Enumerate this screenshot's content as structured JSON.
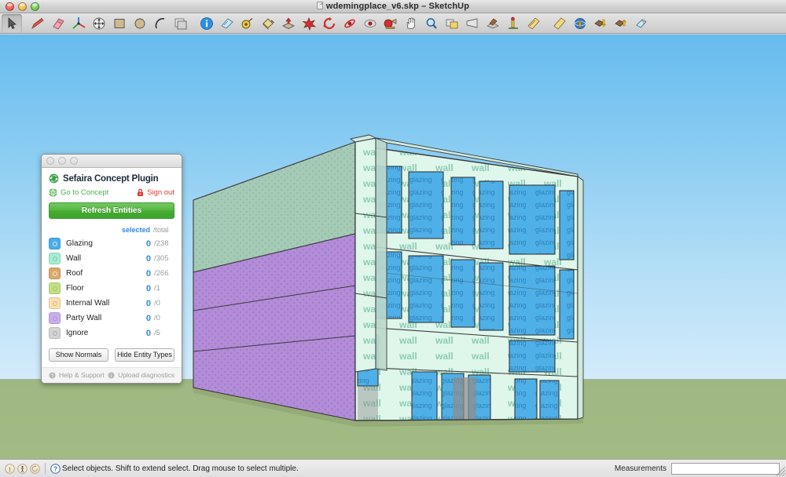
{
  "window": {
    "title": "wdemingplace_v6.skp – SketchUp",
    "app": "SketchUp",
    "document": "wdemingplace_v6.skp",
    "controls": [
      {
        "name": "close",
        "color": "#e0483c"
      },
      {
        "name": "minimize",
        "color": "#e8a62c"
      },
      {
        "name": "zoom",
        "color": "#4fb733"
      }
    ]
  },
  "toolbar": {
    "items": [
      {
        "name": "select-tool",
        "label": "Select",
        "active": true
      },
      {
        "name": "line-tool",
        "label": "Line",
        "active": false
      },
      {
        "name": "eraser-tool",
        "label": "Eraser",
        "active": false
      },
      {
        "name": "axes-tool",
        "label": "Axes",
        "active": false
      },
      {
        "name": "move-tool",
        "label": "Move",
        "active": false
      },
      {
        "name": "rectangle-tool",
        "label": "Rectangle",
        "active": false
      },
      {
        "name": "circle-tool",
        "label": "Circle",
        "active": false
      },
      {
        "name": "arc-tool",
        "label": "Arc",
        "active": false
      },
      {
        "name": "offset-tool",
        "label": "Offset",
        "active": false
      },
      {
        "name": "entity-info-tool",
        "label": "Entity Info",
        "active": false
      },
      {
        "name": "protractor-tool",
        "label": "Protractor",
        "active": false
      },
      {
        "name": "tape-measure-tool",
        "label": "Tape Measure",
        "active": false
      },
      {
        "name": "paint-bucket-tool",
        "label": "Paint Bucket",
        "active": false
      },
      {
        "name": "push-pull-tool",
        "label": "Push/Pull",
        "active": false
      },
      {
        "name": "follow-me-tool",
        "label": "Follow Me",
        "active": false
      },
      {
        "name": "rotate-tool",
        "label": "Rotate",
        "active": false
      },
      {
        "name": "orbit-tool",
        "label": "Orbit",
        "active": false
      },
      {
        "name": "look-around-tool",
        "label": "Look Around",
        "active": false
      },
      {
        "name": "walk-tool",
        "label": "Walk",
        "active": false
      },
      {
        "name": "pan-tool",
        "label": "Pan",
        "active": false
      },
      {
        "name": "zoom-tool",
        "label": "Zoom",
        "active": false
      },
      {
        "name": "zoom-extents-tool",
        "label": "Zoom Extents",
        "active": false
      },
      {
        "name": "zoom-window-tool",
        "label": "Zoom Window",
        "active": false
      },
      {
        "name": "previous-view-tool",
        "label": "Previous View",
        "active": false
      },
      {
        "name": "position-camera-tool",
        "label": "Position Camera",
        "active": false
      },
      {
        "name": "section-plane-tool",
        "label": "Section Plane",
        "active": false
      },
      {
        "name": "dimension-tool",
        "label": "Dimension",
        "active": false
      },
      {
        "name": "upload-model-tool",
        "label": "Share Model",
        "active": false
      },
      {
        "name": "download-component-tool",
        "label": "Get Models",
        "active": false
      },
      {
        "name": "upload-component-tool",
        "label": "Share Component",
        "active": false
      },
      {
        "name": "make-component-tool",
        "label": "Make Component",
        "active": false
      }
    ]
  },
  "plugin_panel": {
    "title": "Sefaira Concept Plugin",
    "logo_icon": "sefaira-logo-icon",
    "links": {
      "concept": {
        "label": "Go to Concept",
        "icon": "globe-icon",
        "color": "#4caf50"
      },
      "signout": {
        "label": "Sign out",
        "icon": "lock-icon",
        "color": "#e03a32"
      }
    },
    "refresh_label": "Refresh Entities",
    "columns": {
      "selected": "selected",
      "total": "/total"
    },
    "entities": [
      {
        "name": "Glazing",
        "swatch": "#4aade8",
        "selected": "0",
        "total": "/238"
      },
      {
        "name": "Wall",
        "swatch": "#a6edd3",
        "selected": "0",
        "total": "/305"
      },
      {
        "name": "Roof",
        "swatch": "#dca96b",
        "selected": "0",
        "total": "/266"
      },
      {
        "name": "Floor",
        "swatch": "#c4e083",
        "selected": "0",
        "total": "/1"
      },
      {
        "name": "Internal Wall",
        "swatch": "#fbe0b2",
        "selected": "0",
        "total": "/0"
      },
      {
        "name": "Party Wall",
        "swatch": "#c8afeb",
        "selected": "0",
        "total": "/0"
      },
      {
        "name": "Ignore",
        "swatch": "#d4d4d4",
        "selected": "0",
        "total": "/5"
      }
    ],
    "buttons": {
      "show_normals": "Show Normals",
      "hide_entity_types": "Hide Entity Types"
    },
    "footer": {
      "help": "Help & Support",
      "diagnostics": "Upload diagnostics"
    }
  },
  "viewport": {
    "sky_color": "#8ccdf2",
    "ground_color": "#a2bb84",
    "model_face_labels": {
      "wall": "wall",
      "glazing": "glazing"
    },
    "face_colors": {
      "wall": "#ddf6ea",
      "glazing": "#4aade8",
      "roof": "#9dc9b4",
      "party_wall": "#b08ed6",
      "shadow": "#8e8e8e"
    }
  },
  "status_bar": {
    "message": "Select objects. Shift to extend select. Drag mouse to select multiple.",
    "help_icon": "question-mark-icon",
    "left_icons": [
      "context-help-icon",
      "human-scale-icon",
      "refresh-icon"
    ],
    "measurements_label": "Measurements",
    "measurements_value": "",
    "measurements_placeholder": ""
  }
}
